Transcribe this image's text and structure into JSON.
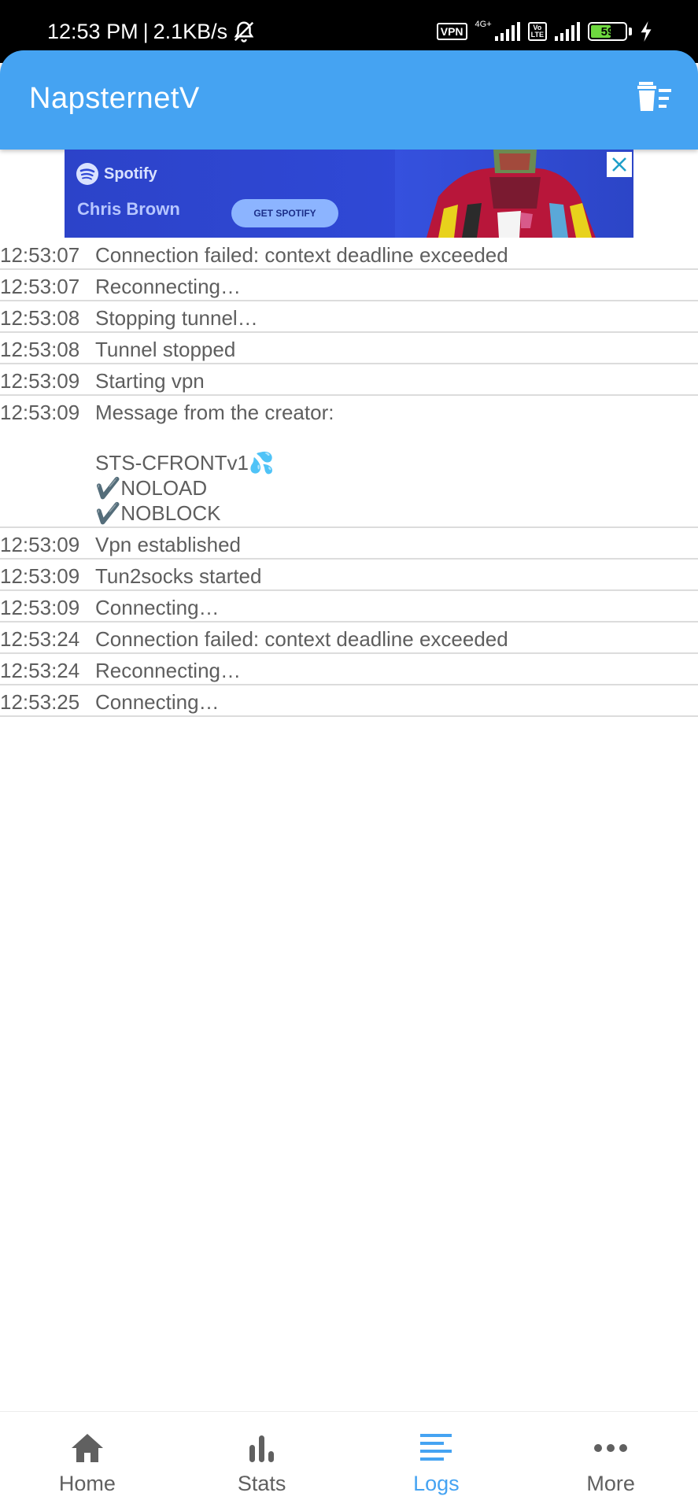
{
  "status_bar": {
    "time": "12:53 PM",
    "separator": "|",
    "speed": "2.1KB/s",
    "vpn_label": "VPN",
    "network_type": "4G+",
    "volte_label": "Vo\nLTE",
    "battery_level": "59",
    "battery_fraction": 0.59
  },
  "app_bar": {
    "title": "NapsternetV",
    "color": "#45a3f2",
    "delete_icon": "trash-list-icon"
  },
  "ad": {
    "brand": "Spotify",
    "artist": "Chris Brown",
    "cta": "GET SPOTIFY",
    "close_icon": "close-icon"
  },
  "logs": [
    {
      "time": "12:53:07",
      "message": "Connection failed: context deadline exceeded"
    },
    {
      "time": "12:53:07",
      "message": "Reconnecting…"
    },
    {
      "time": "12:53:08",
      "message": "Stopping tunnel…"
    },
    {
      "time": "12:53:08",
      "message": "Tunnel stopped"
    },
    {
      "time": "12:53:09",
      "message": "Starting vpn"
    },
    {
      "time": "12:53:09",
      "message": "Message from the creator:\n\nSTS-CFRONTv1💦\n✔️NOLOAD\n✔️NOBLOCK"
    },
    {
      "time": "12:53:09",
      "message": "Vpn established"
    },
    {
      "time": "12:53:09",
      "message": "Tun2socks started"
    },
    {
      "time": "12:53:09",
      "message": "Connecting…"
    },
    {
      "time": "12:53:24",
      "message": "Connection failed: context deadline exceeded"
    },
    {
      "time": "12:53:24",
      "message": "Reconnecting…"
    },
    {
      "time": "12:53:25",
      "message": "Connecting…"
    }
  ],
  "bottom_nav": {
    "items": [
      {
        "label": "Home",
        "icon": "home-icon",
        "active": false
      },
      {
        "label": "Stats",
        "icon": "bar-chart-icon",
        "active": false
      },
      {
        "label": "Logs",
        "icon": "logs-icon",
        "active": true
      },
      {
        "label": "More",
        "icon": "more-dots-icon",
        "active": false
      }
    ],
    "active_color": "#45a3f2"
  }
}
